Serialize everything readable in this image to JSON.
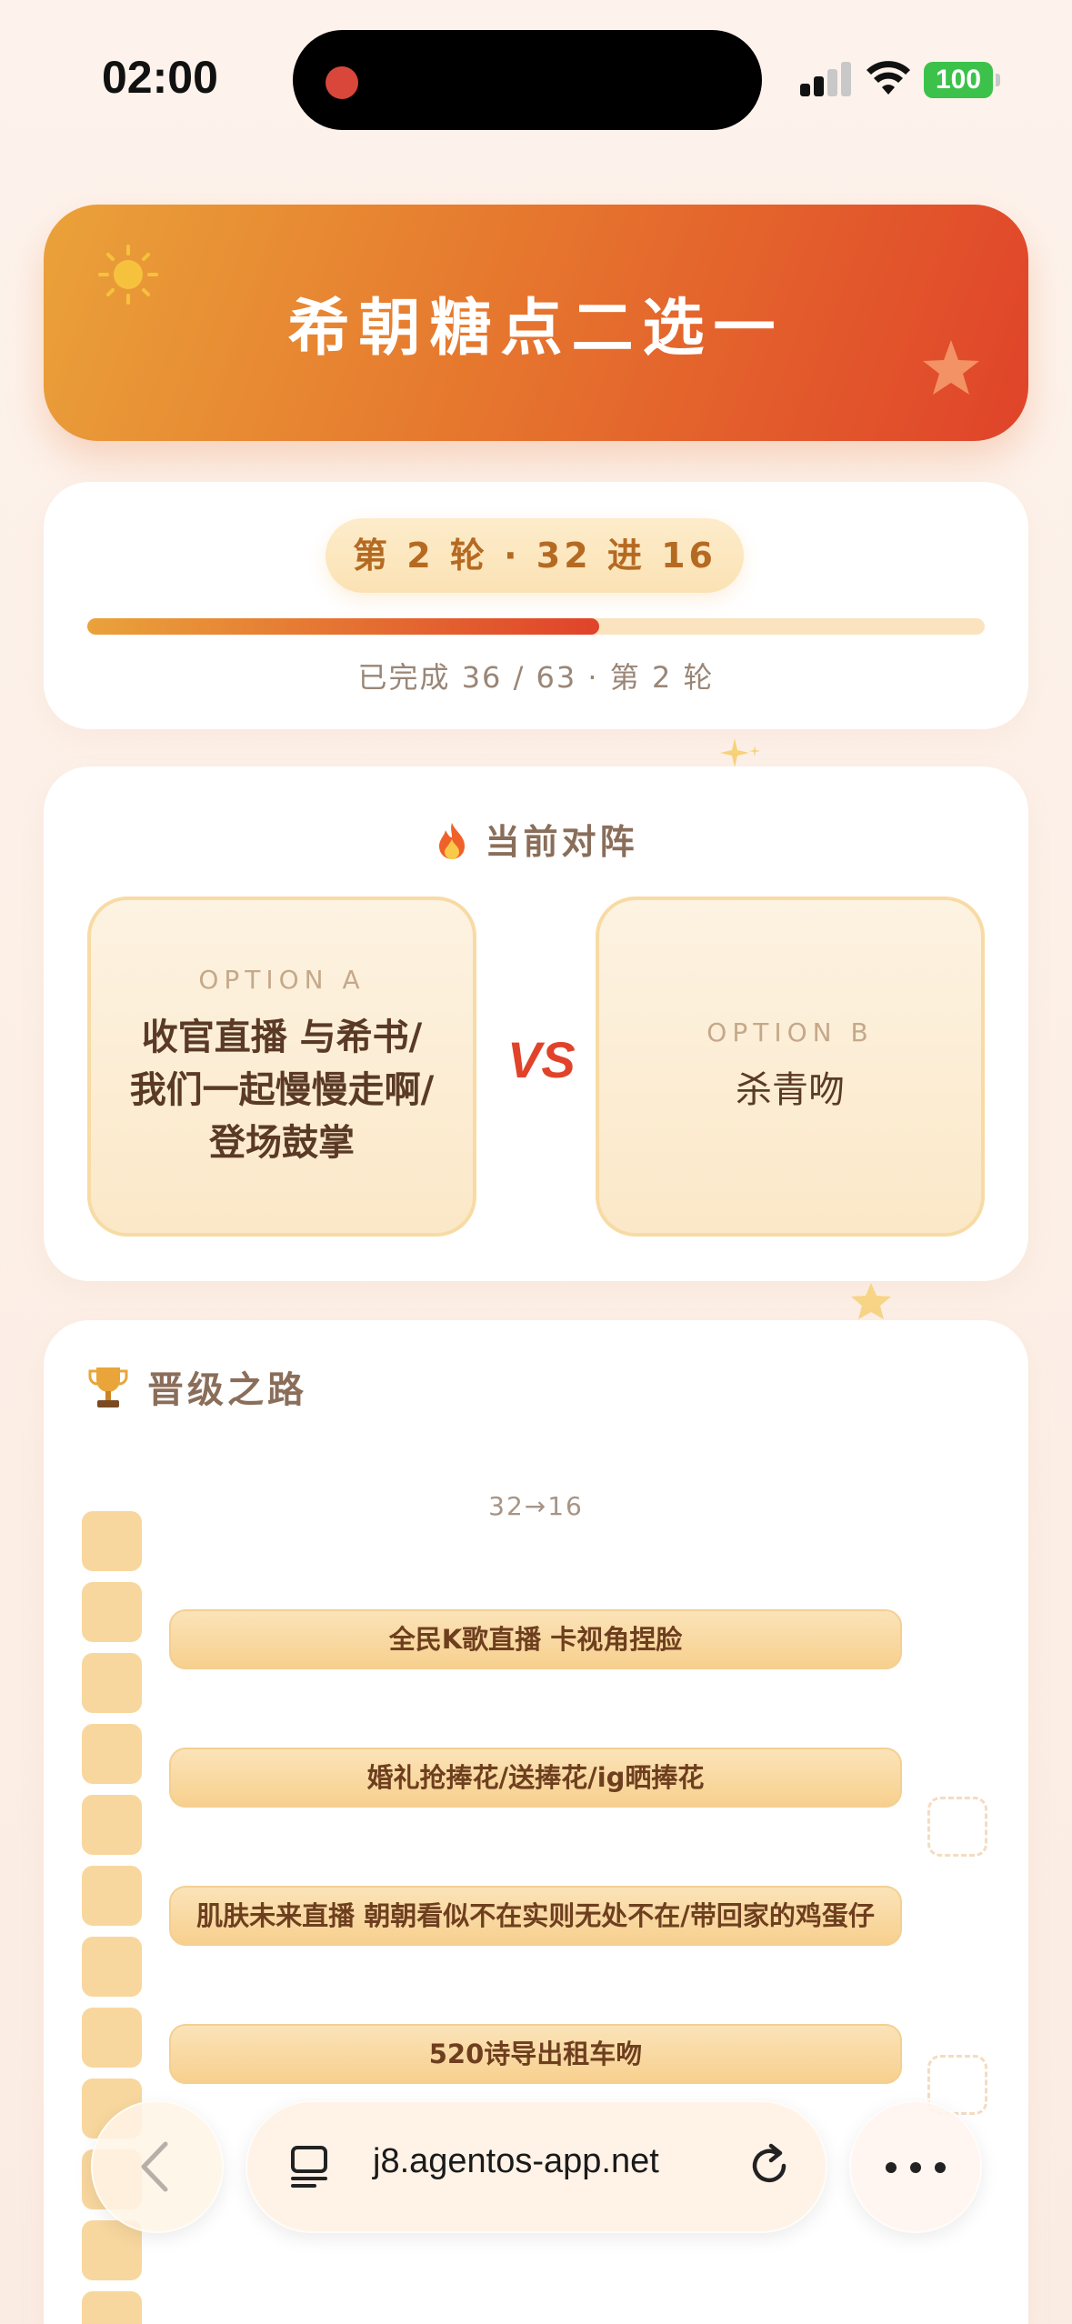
{
  "status_bar": {
    "time": "02:00",
    "battery": "100"
  },
  "header": {
    "title": "希朝糖点二选一"
  },
  "progress": {
    "round_pill": "第 2 轮 · 32 进 16",
    "completed_text": "已完成 36 / 63 · 第 2 轮",
    "completed": 36,
    "total": 63,
    "bar_fraction": 0.57
  },
  "match": {
    "title": "当前对阵",
    "option_a": {
      "tag": "OPTION A",
      "text": "收官直播 与希书/我们一起慢慢走啊/登场鼓掌"
    },
    "vs": "VS",
    "option_b": {
      "tag": "OPTION B",
      "text": "杀青吻"
    }
  },
  "road": {
    "title": "晋级之路",
    "round_label": "32→16",
    "items": [
      "全民K歌直播 卡视角捏脸",
      "婚礼抢捧花/送捧花/ig晒捧花",
      "肌肤未来直播 朝朝看似不在实则无处不在/带回家的鸡蛋仔",
      "520诗导出租车吻"
    ]
  },
  "browser": {
    "url": "j8.agentos-app.net"
  },
  "colors": {
    "accent_orange": "#e6782e",
    "accent_red": "#e0432a",
    "accent_gold": "#eaa23a"
  }
}
